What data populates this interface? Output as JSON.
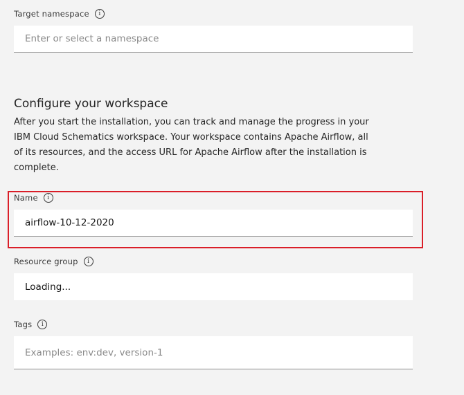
{
  "target_namespace": {
    "label": "Target namespace",
    "placeholder": "Enter or select a namespace",
    "value": ""
  },
  "workspace": {
    "title": "Configure your workspace",
    "description": "After you start the installation, you can track and manage the progress in your IBM Cloud Schematics workspace. Your workspace contains Apache Airflow, all of its resources, and the access URL for Apache Airflow after the installation is complete."
  },
  "name_field": {
    "label": "Name",
    "value": "airflow-10-12-2020"
  },
  "resource_group": {
    "label": "Resource group",
    "value": "Loading..."
  },
  "tags": {
    "label": "Tags",
    "placeholder": "Examples: env:dev, version-1",
    "value": ""
  },
  "icons": {
    "info": "info-icon"
  },
  "colors": {
    "highlight": "#da1e28",
    "background": "#f3f3f3",
    "field_bg": "#ffffff"
  }
}
